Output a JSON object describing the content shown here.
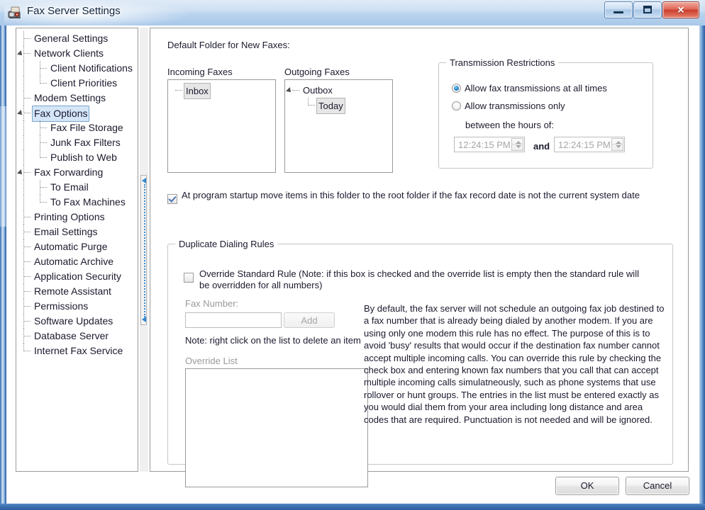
{
  "window": {
    "title": "Fax Server Settings",
    "icon": "fax-machine-icon",
    "controls": {
      "minimize": "Minimize",
      "maximize": "Maximize",
      "close": "✕"
    }
  },
  "sidebar": {
    "items": [
      {
        "label": "General Settings",
        "level": 1,
        "expander": false,
        "selected": false
      },
      {
        "label": "Network Clients",
        "level": 1,
        "expander": true,
        "selected": false
      },
      {
        "label": "Client Notifications",
        "level": 2,
        "expander": false,
        "selected": false
      },
      {
        "label": "Client Priorities",
        "level": 2,
        "expander": false,
        "selected": false
      },
      {
        "label": "Modem Settings",
        "level": 1,
        "expander": false,
        "selected": false
      },
      {
        "label": "Fax Options",
        "level": 1,
        "expander": true,
        "selected": true
      },
      {
        "label": "Fax File Storage",
        "level": 2,
        "expander": false,
        "selected": false
      },
      {
        "label": "Junk Fax Filters",
        "level": 2,
        "expander": false,
        "selected": false
      },
      {
        "label": "Publish to Web",
        "level": 2,
        "expander": false,
        "selected": false
      },
      {
        "label": "Fax Forwarding",
        "level": 1,
        "expander": true,
        "selected": false
      },
      {
        "label": "To Email",
        "level": 2,
        "expander": false,
        "selected": false
      },
      {
        "label": "To Fax Machines",
        "level": 2,
        "expander": false,
        "selected": false
      },
      {
        "label": "Printing Options",
        "level": 1,
        "expander": false,
        "selected": false
      },
      {
        "label": "Email Settings",
        "level": 1,
        "expander": false,
        "selected": false
      },
      {
        "label": "Automatic Purge",
        "level": 1,
        "expander": false,
        "selected": false
      },
      {
        "label": "Automatic Archive",
        "level": 1,
        "expander": false,
        "selected": false
      },
      {
        "label": "Application Security",
        "level": 1,
        "expander": false,
        "selected": false
      },
      {
        "label": "Remote Assistant",
        "level": 1,
        "expander": false,
        "selected": false
      },
      {
        "label": "Permissions",
        "level": 1,
        "expander": false,
        "selected": false
      },
      {
        "label": "Software Updates",
        "level": 1,
        "expander": false,
        "selected": false
      },
      {
        "label": "Database Server",
        "level": 1,
        "expander": false,
        "selected": false
      },
      {
        "label": "Internet Fax Service",
        "level": 1,
        "expander": false,
        "selected": false
      }
    ]
  },
  "main": {
    "default_folder_heading": "Default Folder for New Faxes:",
    "incoming": {
      "caption": "Incoming Faxes",
      "nodes": [
        {
          "label": "Inbox",
          "level": 1,
          "expander": false,
          "selected": true
        }
      ]
    },
    "outgoing": {
      "caption": "Outgoing Faxes",
      "nodes": [
        {
          "label": "Outbox",
          "level": 1,
          "expander": true,
          "selected": false
        },
        {
          "label": "Today",
          "level": 2,
          "expander": false,
          "selected": true
        }
      ]
    },
    "transmission": {
      "title": "Transmission Restrictions",
      "option_all_times": "Allow fax transmissions at all times",
      "option_only": "Allow transmissions only",
      "between_label": "between the hours of:",
      "time_start": "12:24:15 PM",
      "and_label": "and",
      "time_end": "12:24:15 PM",
      "selected_option": "all_times"
    },
    "startup_move": {
      "checked": true,
      "label": "At program startup move items in this folder to the root folder if the fax record date is not the current system date"
    },
    "duplicate_rules": {
      "title": "Duplicate Dialing Rules",
      "override_checkbox": {
        "checked": false,
        "label": "Override Standard Rule (Note: if this box is checked and the override list is empty then the standard rule will be overridden for all numbers)"
      },
      "fax_number_label": "Fax Number:",
      "fax_number_value": "",
      "fax_number_placeholder": "",
      "add_button": "Add",
      "note": "Note: right click on the list to delete an item",
      "override_list_label": "Override List",
      "override_list_items": [],
      "description": "By default, the fax server will not schedule an outgoing fax job destined to a fax number that is already being dialed by another modem.  If you are using only one modem this rule has no effect.  The purpose of this is to avoid 'busy' results that would occur if the destination fax number cannot accept multiple incoming calls.  You can override this rule by checking the check box and entering known fax numbers that you call that can accept multiple incoming calls simulatneously, such as phone systems that use rollover or hunt groups.  The entries in the list must be entered exactly as you would dial them from your area including long distance and area codes that are required.  Punctuation is not needed and will be ignored."
    }
  },
  "footer": {
    "ok": "OK",
    "cancel": "Cancel"
  },
  "colors": {
    "accent": "#1e80c8",
    "selection_active": "#d4e6f8",
    "selection_inactive": "#e6e6e6",
    "titlebar_text": "#10243d",
    "disabled_text": "#9a9a9a",
    "close_button": "#c93e2d"
  }
}
